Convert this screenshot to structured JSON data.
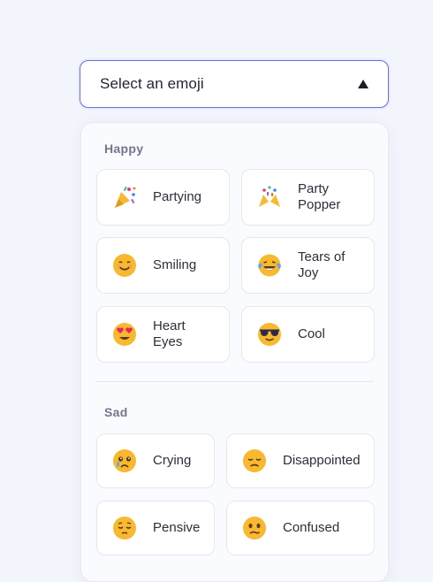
{
  "select": {
    "label": "Select an emoji"
  },
  "groups": [
    {
      "title": "Happy",
      "options": [
        {
          "label": "Partying",
          "icon": "party-popper-icon"
        },
        {
          "label": "Party Popper",
          "icon": "confetti-icon"
        },
        {
          "label": "Smiling",
          "icon": "smiling-face-icon"
        },
        {
          "label": "Tears of Joy",
          "icon": "tears-of-joy-icon"
        },
        {
          "label": "Heart Eyes",
          "icon": "heart-eyes-icon"
        },
        {
          "label": "Cool",
          "icon": "sunglasses-face-icon"
        }
      ]
    },
    {
      "title": "Sad",
      "options": [
        {
          "label": "Crying",
          "icon": "crying-face-icon"
        },
        {
          "label": "Disappointed",
          "icon": "disappointed-face-icon"
        },
        {
          "label": "Pensive",
          "icon": "pensive-face-icon"
        },
        {
          "label": "Confused",
          "icon": "confused-face-icon"
        }
      ]
    }
  ],
  "colors": {
    "accent": "#6a6fe0",
    "emoji_yellow": "#f8b830",
    "background": "#f3f5fd"
  }
}
